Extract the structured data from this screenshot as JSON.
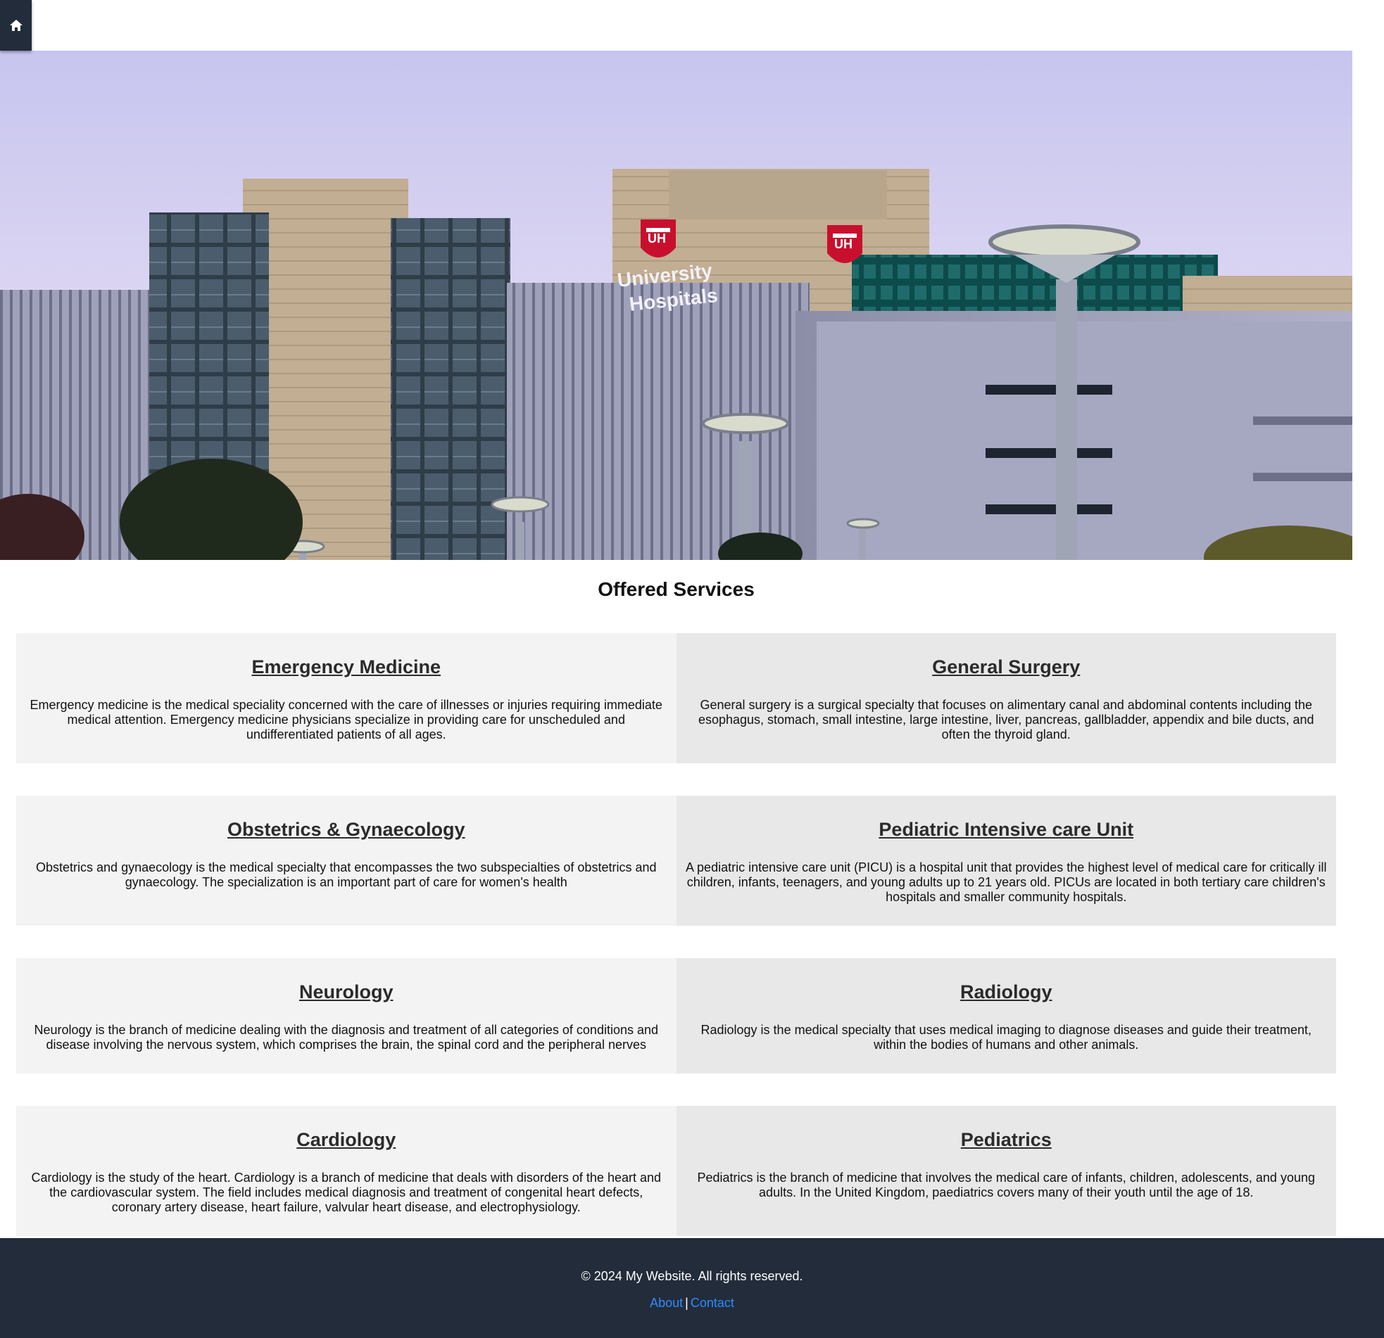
{
  "nav": {
    "home_icon": "home-icon"
  },
  "hero": {
    "image_alt": "University Hospitals building",
    "sign_line1": "University",
    "sign_line2": "Hospitals",
    "logo_text": "UH"
  },
  "services": {
    "title": "Offered Services",
    "rows": [
      [
        {
          "title": "Emergency Medicine",
          "desc": "Emergency medicine is the medical speciality concerned with the care of illnesses or injuries requiring immediate medical attention. Emergency medicine physicians specialize in providing care for unscheduled and undifferentiated patients of all ages."
        },
        {
          "title": "General Surgery",
          "desc": "General surgery is a surgical specialty that focuses on alimentary canal and abdominal contents including the esophagus, stomach, small intestine, large intestine, liver, pancreas, gallbladder, appendix and bile ducts, and often the thyroid gland."
        }
      ],
      [
        {
          "title": "Obstetrics & Gynaecology",
          "desc": "Obstetrics and gynaecology is the medical specialty that encompasses the two subspecialties of obstetrics and gynaecology. The specialization is an important part of care for women's health"
        },
        {
          "title": "Pediatric Intensive care Unit",
          "desc": "A pediatric intensive care unit (PICU) is a hospital unit that provides the highest level of medical care for critically ill children, infants, teenagers, and young adults up to 21 years old. PICUs are located in both tertiary care children's hospitals and smaller community hospitals."
        }
      ],
      [
        {
          "title": "Neurology",
          "desc": "Neurology is the branch of medicine dealing with the diagnosis and treatment of all categories of conditions and disease involving the nervous system, which comprises the brain, the spinal cord and the peripheral nerves"
        },
        {
          "title": "Radiology",
          "desc": "Radiology is the medical specialty that uses medical imaging to diagnose diseases and guide their treatment, within the bodies of humans and other animals."
        }
      ],
      [
        {
          "title": "Cardiology",
          "desc": "Cardiology is the study of the heart. Cardiology is a branch of medicine that deals with disorders of the heart and the cardiovascular system. The field includes medical diagnosis and treatment of congenital heart defects, coronary artery disease, heart failure, valvular heart disease, and electrophysiology."
        },
        {
          "title": "Pediatrics",
          "desc": "Pediatrics is the branch of medicine that involves the medical care of infants, children, adolescents, and young adults. In the United Kingdom, paediatrics covers many of their youth until the age of 18."
        }
      ]
    ]
  },
  "footer": {
    "copyright": "© 2024 My Website. All rights reserved.",
    "about": "About",
    "separator": "|",
    "contact": "Contact"
  },
  "colors": {
    "nav_bg": "#222c3a",
    "footer_bg": "#222c3a",
    "link": "#2f8cff",
    "card_left": "#f3f3f3",
    "card_right": "#e8e8e8"
  }
}
